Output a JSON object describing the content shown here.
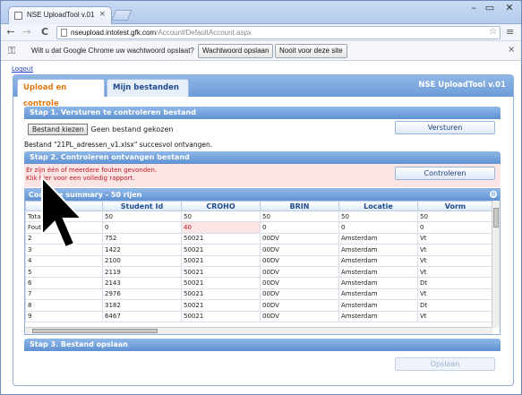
{
  "browser": {
    "tab_title": "NSE UploadTool v.01",
    "tab_close": "×",
    "window_min": "–",
    "window_max": "▭",
    "window_close": "✕",
    "back": "←",
    "forward": "→",
    "reload": "C",
    "url_host": "nseupload.intotest.gfk.com",
    "url_path": "/Account/DefaultAccount.aspx",
    "star": "☆",
    "menu": "≡"
  },
  "infobar": {
    "message": "Wilt u dat Google Chrome uw wachtwoord opslaat?",
    "save_button": "Wachtwoord opslaan",
    "never_button": "Nooit voor deze site",
    "close": "×"
  },
  "page": {
    "logout": "Logout",
    "app_title": "NSE UploadTool v.01",
    "tabs": [
      {
        "label": "Upload en controle"
      },
      {
        "label": "Mijn bestanden"
      }
    ],
    "step1": {
      "title": "Stap 1. Versturen te controleren bestand",
      "choose_button": "Bestand kiezen",
      "no_file": "Geen bestand gekozen",
      "send_button": "Versturen",
      "success": "Bestand \"21PL_adressen_v1.xlsx\" succesvol ontvangen."
    },
    "step2": {
      "title": "Stap 2. Controleren ontvangen bestand",
      "error1": "Er zijn één of meerdere fouten gevonden.",
      "error2": "Klik hier voor een volledig rapport.",
      "check_button": "Controleren"
    },
    "summary": {
      "title": "Controle summary - 50 rijen",
      "toggle": "⊖",
      "columns": [
        "",
        "Student Id",
        "CROHO",
        "BRIN",
        "Locatie",
        "Vorm"
      ],
      "rows": [
        [
          "Totaal",
          "50",
          "50",
          "50",
          "50",
          "50"
        ],
        [
          "Fouten",
          "0",
          "40",
          "0",
          "0",
          "0"
        ],
        [
          "2",
          "752",
          "50021",
          "00DV",
          "Amsterdam",
          "Vt"
        ],
        [
          "3",
          "1422",
          "50021",
          "00DV",
          "Amsterdam",
          "Vt"
        ],
        [
          "4",
          "2100",
          "50021",
          "00DV",
          "Amsterdam",
          "Vt"
        ],
        [
          "5",
          "2119",
          "50021",
          "00DV",
          "Amsterdam",
          "Vt"
        ],
        [
          "6",
          "2143",
          "50021",
          "00DV",
          "Amsterdam",
          "Dt"
        ],
        [
          "7",
          "2976",
          "50021",
          "00DV",
          "Amsterdam",
          "Vt"
        ],
        [
          "8",
          "3182",
          "50021",
          "00DV",
          "Amsterdam",
          "Dt"
        ],
        [
          "9",
          "6467",
          "50021",
          "00DV",
          "Amsterdam",
          "Vt"
        ]
      ]
    },
    "step3": {
      "title": "Stap 3. Bestand opslaan",
      "save_button": "Opslaan"
    }
  }
}
